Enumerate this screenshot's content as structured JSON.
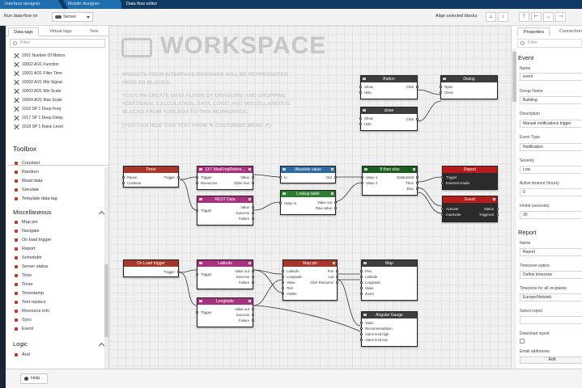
{
  "top_tabs": [
    "Interface designer",
    "Mobile designer",
    "Data flow editor"
  ],
  "toolbar": {
    "run_label": "Run data-flow on",
    "run_target": "Server",
    "align_label": "Align selected blocks",
    "align_buttons": [
      "⊥",
      "↕",
      "⊤",
      "⊢",
      "↔",
      "⊣"
    ]
  },
  "left": {
    "tabs": [
      "Data tags",
      "Virtual tags",
      "Tree"
    ],
    "filter_placeholder": "Filter",
    "tags": [
      "1001 Number Of Motors",
      "10002 AO1 Function",
      "10001 AO1 Filter Time",
      "10002 AO1 Min Signal",
      "10003 AO1 Min Scale",
      "10004 AO1 Max Scale",
      "1016 SP 1 Deep Freq",
      "1017 SP 1 Deep Delay",
      "1018 SP 1 Raise Level"
    ],
    "toolbox_title": "Toolbox",
    "toolbox_items": [
      "Constant",
      "Random",
      "Read data",
      "Simulate",
      "Template data tag"
    ],
    "misc_title": "Miscellaneous",
    "misc_items": [
      "Map pin",
      "Navigate",
      "On load trigger",
      "Report",
      "Scheduler",
      "Server status",
      "Time",
      "Timer",
      "Timestamp",
      "Text replace",
      "Resource info",
      "Sync",
      "Event"
    ],
    "logic_title": "Logic",
    "logic_items": [
      "And"
    ]
  },
  "workspace": {
    "title": "WORKSPACE",
    "lines1": [
      "WIDGETS FROM INTERFACE DESIGNER WILL BE REPRESENTED",
      "HERE AS BLOCKS."
    ],
    "lines2": [
      "YOU CAN CREATE DATA FLOWS BY DRAGGING AND DROPPING",
      "ADDITIONAL CALCULATION, DATA, LOGIC AND MISCELLANEOUS",
      "BLOCKS FROM TOOLBOX TO THIS WORKSPACE."
    ],
    "line3": "(YOU CAN HIDE THIS TEXT FROM ✎ CUSTOMIZE MENU ↗)"
  },
  "blocks": {
    "button": {
      "title": "Button",
      "in": [
        "Show",
        "Hide"
      ],
      "out": [
        "Click"
      ]
    },
    "dialog": {
      "title": "Dialog",
      "in": [
        "Open",
        "Close"
      ],
      "out": []
    },
    "close": {
      "title": "close",
      "in": [
        "Show",
        "Hide"
      ],
      "out": [
        "Click"
      ]
    },
    "timer": {
      "title": "Timer",
      "in": [
        "Pause",
        "Continue"
      ],
      "out": [
        "Trigger"
      ]
    },
    "rest1": {
      "title": "1X7 MaxFreqRefere...",
      "in": [
        "Trigger",
        "Resources"
      ],
      "out": [
        "Value",
        "Other text"
      ]
    },
    "rest2": {
      "title": "REST Data",
      "in": [
        "Trigger"
      ],
      "out": [
        "Value",
        "Success",
        "Failure"
      ]
    },
    "abs": {
      "title": "Absolute value",
      "in": [
        "In"
      ],
      "out": [
        "Out"
      ]
    },
    "lookup": {
      "title": "Lookup table",
      "in": [
        "Value in"
      ],
      "out": [
        "Value out",
        "Raw value"
      ]
    },
    "ifthen": {
      "title": "If then else",
      "in": [
        "Value 1",
        "Value 2"
      ],
      "out": [
        "Subtracted",
        "Then",
        "Else"
      ]
    },
    "report": {
      "title": "Report",
      "in": [
        "Trigger",
        "External emails"
      ],
      "out": []
    },
    "event": {
      "title": "Event",
      "in": [
        "Activate",
        "Inactivate"
      ],
      "out": [
        "Status",
        "Triggered"
      ]
    },
    "onload": {
      "title": "On Load trigger",
      "in": [],
      "out": [
        "Trigger"
      ]
    },
    "latitude": {
      "title": "Latitude",
      "in": [
        "Trigger"
      ],
      "out": [
        "Value out",
        "Success",
        "Failure"
      ]
    },
    "longitude": {
      "title": "Longitude",
      "in": [
        "Trigger"
      ],
      "out": [
        "Value out",
        "Success",
        "Failure"
      ]
    },
    "mappin": {
      "title": "Map pin",
      "in": [
        "Latitude",
        "Longitude",
        "Value",
        "Text",
        "Visible"
      ],
      "out": [
        "Pos",
        "Lat",
        "Click Resource"
      ]
    },
    "map": {
      "title": "Map",
      "in": [
        "Pins",
        "Latitude",
        "Longitude",
        "Value",
        "Zoom"
      ],
      "out": []
    },
    "angular": {
      "title": "Angular Gauge",
      "in": [
        "Value",
        "Recommendation",
        "Alarm limit high",
        "Alarm limit low"
      ],
      "out": []
    }
  },
  "right": {
    "tabs": [
      "Properties",
      "Connections"
    ],
    "filter_placeholder": "Filter",
    "sect1": "Event",
    "name_label": "Name",
    "name_value": "event",
    "group_label": "Group Name",
    "group_value": "Building",
    "desc_label": "Description",
    "desc_value": "Manual notifications trigger",
    "type_label": "Event Type",
    "type_value": "Notification",
    "sev_label": "Severity",
    "sev_value": "Low",
    "active_label": "Active timeout (hours)",
    "active_value": "0",
    "inhibit_label": "Inhibit (seconds)",
    "inhibit_value": "30",
    "sect2": "Report",
    "rname_label": "Name",
    "rname_value": "Report",
    "tz_label": "Timezone option",
    "tz_value": "Define timezone",
    "tzall_label": "Timezone for all recipients",
    "tzall_value": "Europe/Helsinki",
    "select_label": "Select report",
    "download_label": "Download report",
    "email_label": "Email addresses",
    "edit_label": "Edit"
  },
  "bottom": {
    "help_label": "Help"
  },
  "colors": {
    "rest": "#a8327e",
    "timer": "#a5372b",
    "calc": "#2f6aa0",
    "lookup": "#2e7d32",
    "logic": "#1b5e20",
    "widget": "#3d3d3d",
    "misc_dark": "#b71c1c"
  }
}
